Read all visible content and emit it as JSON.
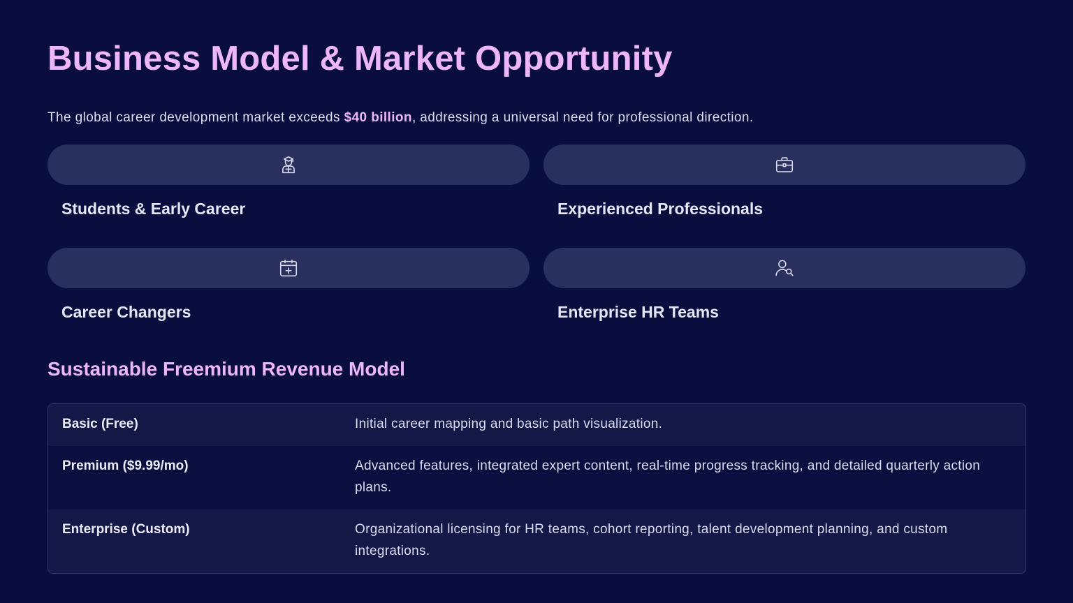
{
  "slide": {
    "title": "Business Model & Market Opportunity",
    "intro": {
      "before": "The global career development market exceeds ",
      "highlight": "$40 billion",
      "after": ", addressing a universal need for professional direction."
    },
    "accent_color": "#edb6f8",
    "background_color": "#0a0e3f",
    "pill_color": "#29305e"
  },
  "segments": [
    {
      "label": "Students & Early Career",
      "icon": "graduate-icon"
    },
    {
      "label": "Experienced Professionals",
      "icon": "briefcase-icon"
    },
    {
      "label": "Career Changers",
      "icon": "calendar-plus-icon"
    },
    {
      "label": "Enterprise HR Teams",
      "icon": "user-search-icon"
    }
  ],
  "revenue": {
    "heading": "Sustainable Freemium Revenue Model",
    "tiers": [
      {
        "name": "Basic (Free)",
        "description": "Initial career mapping and basic path visualization."
      },
      {
        "name": "Premium ($9.99/mo)",
        "description": "Advanced features, integrated expert content, real-time progress tracking, and detailed quarterly action plans."
      },
      {
        "name": "Enterprise (Custom)",
        "description": "Organizational licensing for HR teams, cohort reporting, talent development planning, and custom integrations."
      }
    ]
  }
}
